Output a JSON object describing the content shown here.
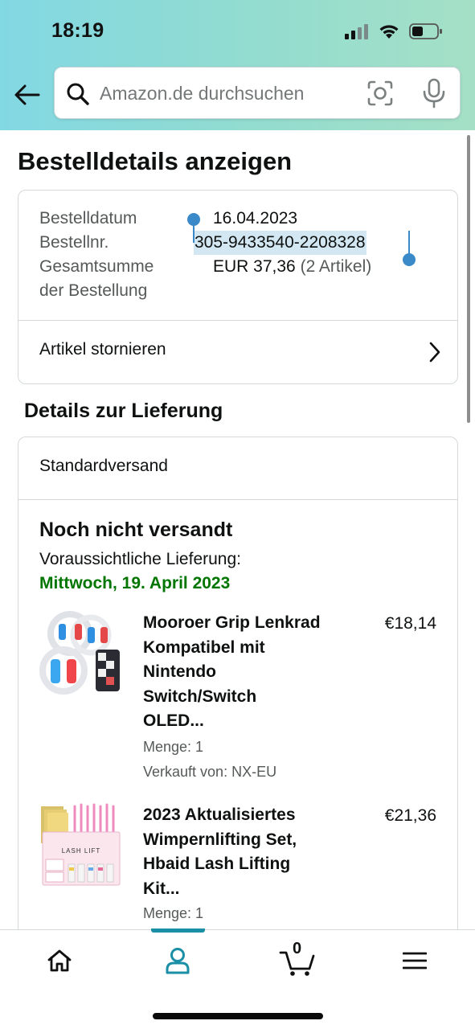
{
  "status_bar": {
    "time": "18:19"
  },
  "search": {
    "placeholder": "Amazon.de durchsuchen",
    "value": ""
  },
  "page": {
    "title": "Bestelldetails anzeigen"
  },
  "order_summary": {
    "date_label": "Bestelldatum",
    "date_value": "16.04.2023",
    "number_label": "Bestellnr.",
    "number_value": "305-9433540-2208328",
    "total_label_line1": "Gesamtsumme",
    "total_label_line2": "der Bestellung",
    "total_value": "EUR 37,36",
    "total_count": "(2 Artikel)",
    "cancel_link": "Artikel stornieren"
  },
  "delivery": {
    "section_title": "Details zur Lieferung",
    "shipping_method": "Standardversand",
    "status": "Noch nicht versandt",
    "expected_label": "Voraussichtliche Lieferung:",
    "expected_date": "Mittwoch, 19. April 2023",
    "items": [
      {
        "title_lines": [
          "Mooroer Grip Lenkrad",
          "Kompatibel mit",
          "Nintendo",
          "Switch/Switch",
          "OLED..."
        ],
        "price": "€18,14",
        "quantity": "Menge: 1",
        "seller": "Verkauft von: NX-EU",
        "thumb": "switch-steering-wheel-image"
      },
      {
        "title_lines": [
          "2023 Aktualisiertes",
          "Wimpernlifting Set,",
          "Hbaid Lash Lifting",
          "Kit..."
        ],
        "price": "€21,36",
        "quantity": "Menge: 1",
        "thumb": "lash-lift-kit-image",
        "thumb_label": "LASH LIFT"
      }
    ]
  },
  "bottom_nav": {
    "items": [
      "home-icon",
      "account-icon",
      "cart-icon",
      "menu-icon"
    ],
    "cart_count": "0",
    "active": "account-icon",
    "accent_color": "#1b8fa6"
  },
  "colors": {
    "delivery_date": "#007600",
    "selection": "#d2e7f2",
    "selection_handle": "#3a89c9"
  }
}
